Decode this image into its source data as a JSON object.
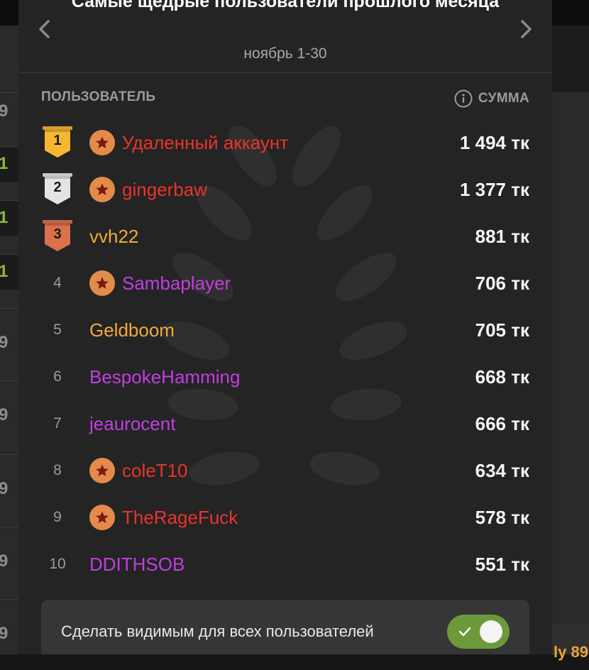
{
  "background": {
    "left_cells": [
      "9",
      "1",
      "1",
      "1",
      "9",
      "9",
      "9",
      "9",
      "9"
    ],
    "right_corner_text": "ly 89"
  },
  "modal": {
    "title": "Самые щедрые пользователи прошлого месяца",
    "subtitle": "ноябрь 1-30"
  },
  "columns": {
    "user": "ПОЛЬЗОВАТЕЛЬ",
    "sum": "СУММА"
  },
  "colors": {
    "gold": "#f5b731",
    "silver": "#e4e4e4",
    "bronze": "#d9714a",
    "red_user": "#e8342c",
    "orange_user": "#f2a93b",
    "purple_user": "#c13fe0",
    "toggle_on": "#6c9a3a"
  },
  "leaderboard": [
    {
      "rank": "1",
      "medal": "gold",
      "badge": true,
      "name": "Удаленный аккаунт",
      "name_color": "#e8342c",
      "amount": "1 494 тк"
    },
    {
      "rank": "2",
      "medal": "silver",
      "badge": true,
      "name": "gingerbaw",
      "name_color": "#e8342c",
      "amount": "1 377 тк"
    },
    {
      "rank": "3",
      "medal": "bronze",
      "badge": false,
      "name": "vvh22",
      "name_color": "#f2a93b",
      "amount": "881 тк"
    },
    {
      "rank": "4",
      "medal": null,
      "badge": true,
      "name": "Sambaplayer",
      "name_color": "#c13fe0",
      "amount": "706 тк"
    },
    {
      "rank": "5",
      "medal": null,
      "badge": false,
      "name": "Geldboom",
      "name_color": "#f2a93b",
      "amount": "705 тк"
    },
    {
      "rank": "6",
      "medal": null,
      "badge": false,
      "name": "BespokeHamming",
      "name_color": "#c13fe0",
      "amount": "668 тк"
    },
    {
      "rank": "7",
      "medal": null,
      "badge": false,
      "name": "jeaurocent",
      "name_color": "#c13fe0",
      "amount": "666 тк"
    },
    {
      "rank": "8",
      "medal": null,
      "badge": true,
      "name": "coleT10",
      "name_color": "#e8342c",
      "amount": "634 тк"
    },
    {
      "rank": "9",
      "medal": null,
      "badge": true,
      "name": "TheRageFuck",
      "name_color": "#e8342c",
      "amount": "578 тк"
    },
    {
      "rank": "10",
      "medal": null,
      "badge": false,
      "name": "DDITHSOB",
      "name_color": "#c13fe0",
      "amount": "551 тк"
    }
  ],
  "visibility": {
    "label": "Сделать видимым для всех пользователей",
    "enabled": true
  },
  "icons": {
    "prev": "chevron-left-icon",
    "next": "chevron-right-icon",
    "info": "info-icon",
    "star": "star-badge-icon",
    "check": "check-icon",
    "medal": "ribbon-medal-icon"
  }
}
